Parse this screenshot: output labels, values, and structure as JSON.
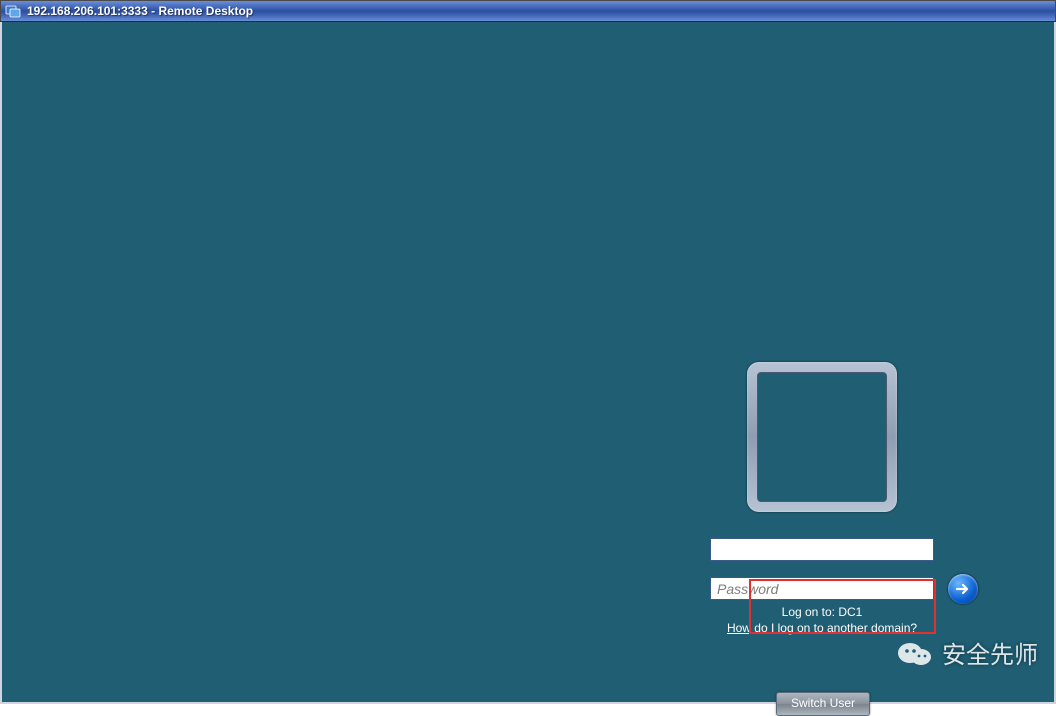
{
  "window": {
    "title": "192.168.206.101:3333 - Remote Desktop"
  },
  "login": {
    "username_value": "",
    "password_placeholder": "Password",
    "password_value": "",
    "logon_to_label": "Log on to: DC1",
    "domain_help_link": "How do I log on to another domain?",
    "switch_user_label": "Switch User"
  },
  "watermark": {
    "text": "安全先师"
  }
}
